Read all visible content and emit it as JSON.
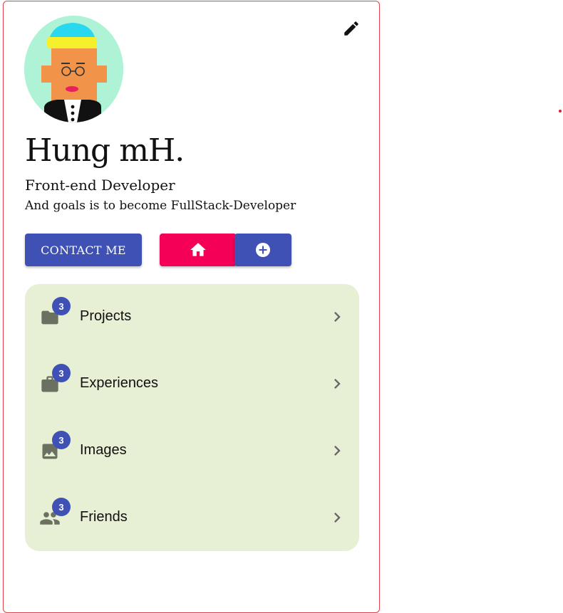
{
  "profile": {
    "name": "Hung mH.",
    "role": "Front-end Developer",
    "goal": "And goals is to become FullStack-Developer"
  },
  "actions": {
    "contact_label": "CONTACT ME",
    "home_icon": "home-icon",
    "add_icon": "add-circle-icon",
    "edit_icon": "pencil-icon"
  },
  "menu": {
    "items": [
      {
        "label": "Projects",
        "badge": "3",
        "icon": "folder-icon"
      },
      {
        "label": "Experiences",
        "badge": "3",
        "icon": "briefcase-icon"
      },
      {
        "label": "Images",
        "badge": "3",
        "icon": "image-icon"
      },
      {
        "label": "Friends",
        "badge": "3",
        "icon": "people-icon"
      }
    ]
  },
  "colors": {
    "primary": "#3f51b5",
    "secondary": "#f50057",
    "menu_bg": "#e7efd5",
    "card_border": "#e0404a",
    "avatar_bg": "#aef3d6"
  }
}
